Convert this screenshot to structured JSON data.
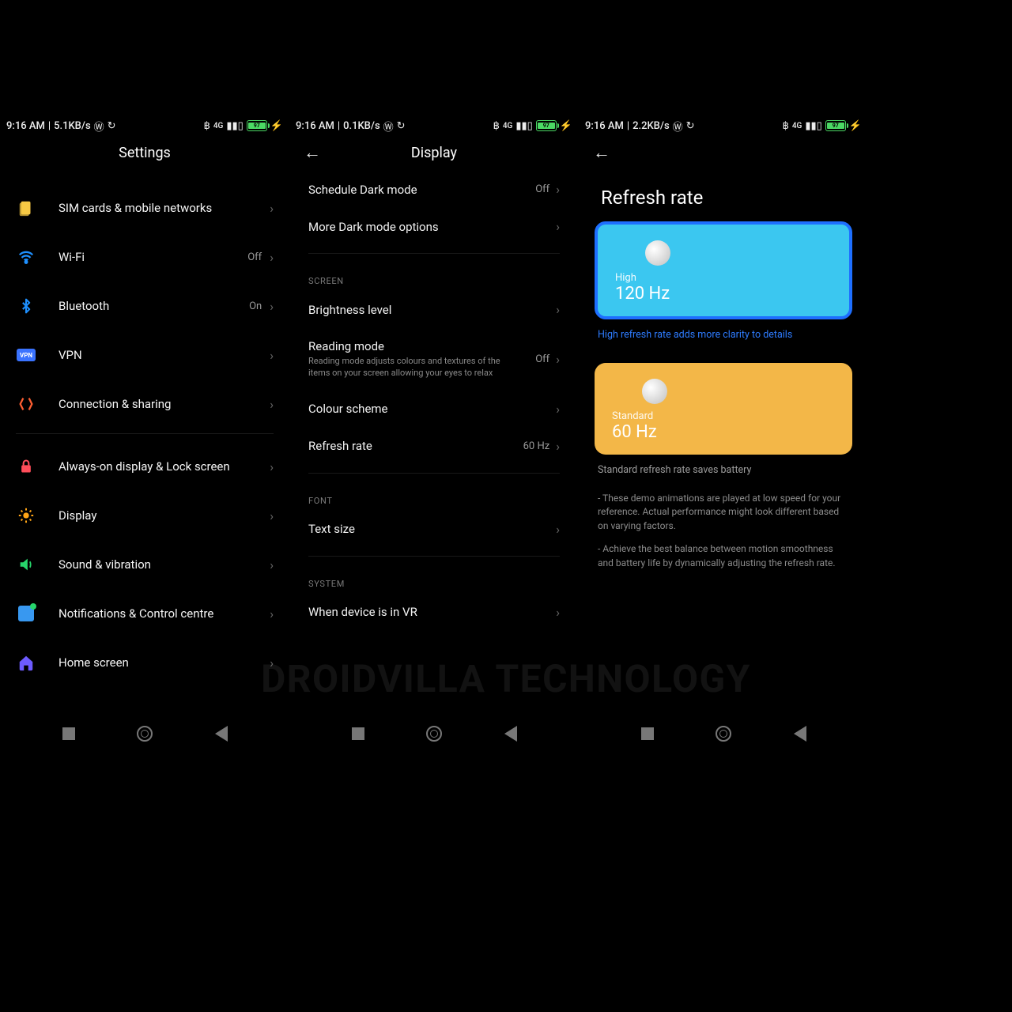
{
  "status": {
    "time": "9:16 AM",
    "speed1": "5.1KB/s",
    "speed2": "0.1KB/s",
    "speed3": "2.2KB/s",
    "signal": "4G",
    "battery": "97"
  },
  "settings": {
    "title": "Settings",
    "items": [
      {
        "label": "SIM cards & mobile networks"
      },
      {
        "label": "Wi-Fi",
        "value": "Off"
      },
      {
        "label": "Bluetooth",
        "value": "On"
      },
      {
        "label": "VPN"
      },
      {
        "label": "Connection & sharing"
      },
      {
        "label": "Always-on display & Lock screen"
      },
      {
        "label": "Display"
      },
      {
        "label": "Sound & vibration"
      },
      {
        "label": "Notifications & Control centre"
      },
      {
        "label": "Home screen"
      }
    ]
  },
  "display": {
    "title": "Display",
    "schedule": {
      "label": "Schedule Dark mode",
      "value": "Off"
    },
    "moreDark": {
      "label": "More Dark mode options"
    },
    "screenHeader": "SCREEN",
    "brightness": {
      "label": "Brightness level"
    },
    "reading": {
      "label": "Reading mode",
      "desc": "Reading mode adjusts colours and textures of the items on your screen allowing your eyes to relax",
      "value": "Off"
    },
    "colour": {
      "label": "Colour scheme"
    },
    "refresh": {
      "label": "Refresh rate",
      "value": "60 Hz"
    },
    "fontHeader": "FONT",
    "textsize": {
      "label": "Text size"
    },
    "systemHeader": "SYSTEM",
    "vr": {
      "label": "When device is in VR"
    }
  },
  "refresh": {
    "title": "Refresh rate",
    "high": {
      "tier": "High",
      "hz": "120 Hz",
      "note": "High refresh rate adds more clarity to details"
    },
    "std": {
      "tier": "Standard",
      "hz": "60 Hz",
      "note": "Standard refresh rate saves battery"
    },
    "fine1": "- These demo animations are played at low speed for your reference. Actual performance might look different based on varying factors.",
    "fine2": "- Achieve the best balance between motion smoothness and battery life by dynamically adjusting the refresh rate."
  },
  "watermark": "DROIDVILLA TECHNOLOGY"
}
